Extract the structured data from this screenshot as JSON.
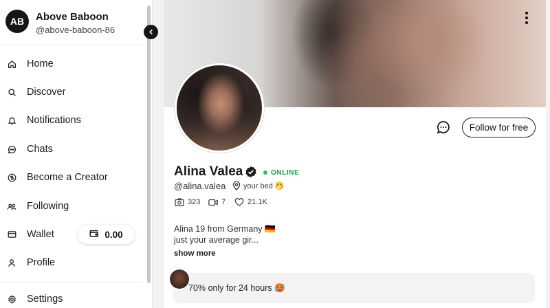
{
  "account": {
    "initials": "AB",
    "name": "Above Baboon",
    "handle": "@above-baboon-86"
  },
  "nav": {
    "items": [
      {
        "label": "Home",
        "icon": "home-icon"
      },
      {
        "label": "Discover",
        "icon": "search-icon"
      },
      {
        "label": "Notifications",
        "icon": "bell-icon"
      },
      {
        "label": "Chats",
        "icon": "chat-bubble-icon"
      },
      {
        "label": "Become a Creator",
        "icon": "dollar-circle-icon"
      },
      {
        "label": "Following",
        "icon": "users-icon"
      },
      {
        "label": "Wallet",
        "icon": "card-icon"
      },
      {
        "label": "Profile",
        "icon": "user-icon"
      },
      {
        "label": "Settings",
        "icon": "gear-icon"
      }
    ],
    "wallet_balance": "0.00"
  },
  "profile": {
    "name": "Alina Valea",
    "status": "ONLINE",
    "handle": "@alina.valea",
    "location": "your bed 🤭",
    "stats": {
      "photos": "323",
      "videos": "7",
      "likes": "21.1K"
    },
    "bio_line1": "Alina 19 from Germany 🇩🇪",
    "bio_line2": "just your average gir...",
    "show_more": "show more",
    "follow_label": "Follow for free",
    "promo_text": "70% only for 24 hours 🥵"
  },
  "colors": {
    "online": "#16a34a",
    "accent": "#111111",
    "promo_bar": "#8ee3a1"
  }
}
